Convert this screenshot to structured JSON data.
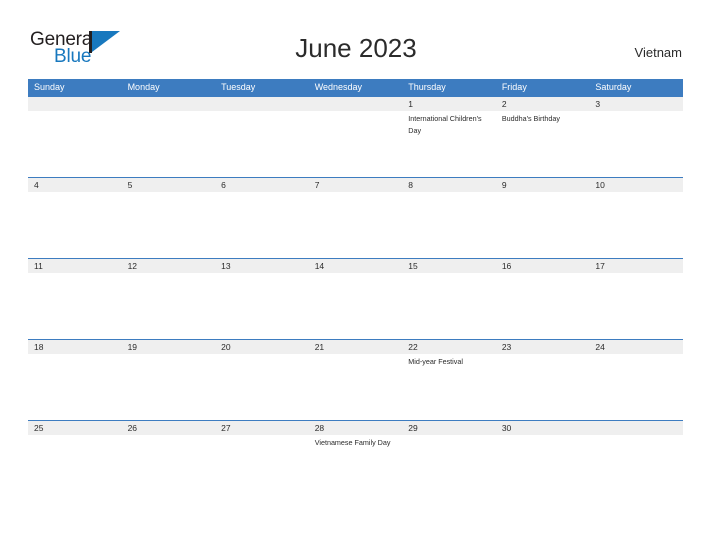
{
  "brand": {
    "name_part1": "General",
    "name_part2": "Blue",
    "logo_icon": "general-blue-triangle-logo",
    "accent_color": "#1878be",
    "text_color": "#231f20"
  },
  "header": {
    "title": "June 2023",
    "country": "Vietnam"
  },
  "colors": {
    "weekday_header_bg": "#3d7cc0",
    "weekday_header_text": "#ffffff",
    "daynum_band_bg": "#efefef",
    "row_divider": "#3d7cc0",
    "page_bg": "#ffffff",
    "body_text": "#2b2b2b"
  },
  "calendar": {
    "month": "June",
    "year": "2023",
    "weekdays": [
      "Sunday",
      "Monday",
      "Tuesday",
      "Wednesday",
      "Thursday",
      "Friday",
      "Saturday"
    ],
    "weeks": [
      {
        "days": [
          {
            "number": "",
            "event": ""
          },
          {
            "number": "",
            "event": ""
          },
          {
            "number": "",
            "event": ""
          },
          {
            "number": "",
            "event": ""
          },
          {
            "number": "1",
            "event": "International Children's Day"
          },
          {
            "number": "2",
            "event": "Buddha's Birthday"
          },
          {
            "number": "3",
            "event": ""
          }
        ]
      },
      {
        "days": [
          {
            "number": "4",
            "event": ""
          },
          {
            "number": "5",
            "event": ""
          },
          {
            "number": "6",
            "event": ""
          },
          {
            "number": "7",
            "event": ""
          },
          {
            "number": "8",
            "event": ""
          },
          {
            "number": "9",
            "event": ""
          },
          {
            "number": "10",
            "event": ""
          }
        ]
      },
      {
        "days": [
          {
            "number": "11",
            "event": ""
          },
          {
            "number": "12",
            "event": ""
          },
          {
            "number": "13",
            "event": ""
          },
          {
            "number": "14",
            "event": ""
          },
          {
            "number": "15",
            "event": ""
          },
          {
            "number": "16",
            "event": ""
          },
          {
            "number": "17",
            "event": ""
          }
        ]
      },
      {
        "days": [
          {
            "number": "18",
            "event": ""
          },
          {
            "number": "19",
            "event": ""
          },
          {
            "number": "20",
            "event": ""
          },
          {
            "number": "21",
            "event": ""
          },
          {
            "number": "22",
            "event": "Mid-year Festival"
          },
          {
            "number": "23",
            "event": ""
          },
          {
            "number": "24",
            "event": ""
          }
        ]
      },
      {
        "days": [
          {
            "number": "25",
            "event": ""
          },
          {
            "number": "26",
            "event": ""
          },
          {
            "number": "27",
            "event": ""
          },
          {
            "number": "28",
            "event": "Vietnamese Family Day"
          },
          {
            "number": "29",
            "event": ""
          },
          {
            "number": "30",
            "event": ""
          },
          {
            "number": "",
            "event": ""
          }
        ]
      }
    ]
  }
}
